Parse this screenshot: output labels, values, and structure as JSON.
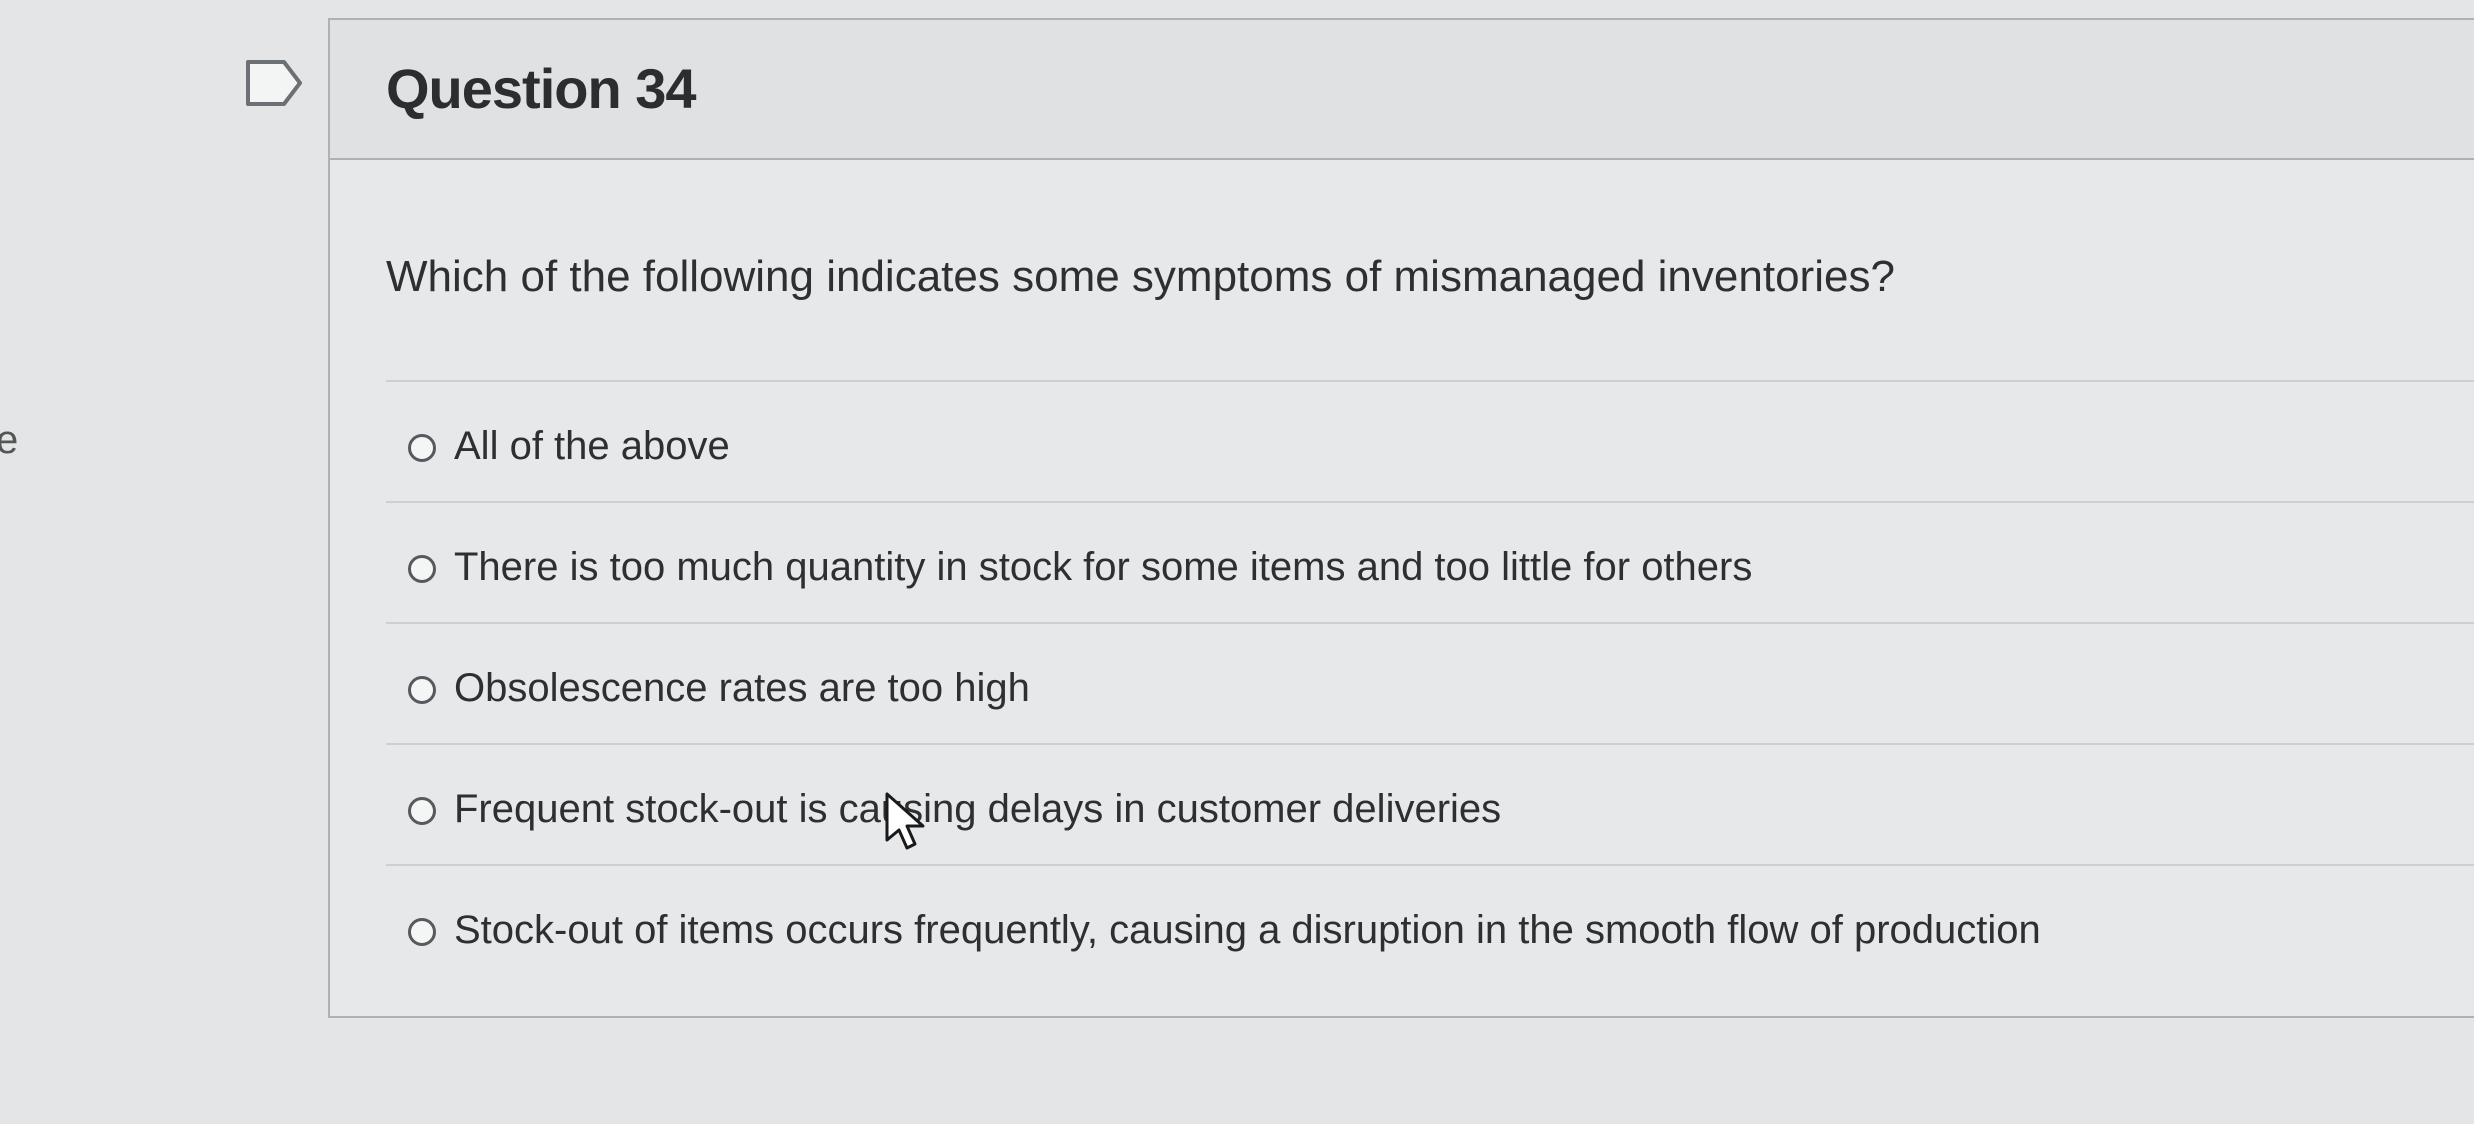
{
  "edge_text": "e",
  "question": {
    "number_label": "Question 34",
    "prompt": "Which of the following indicates some symptoms of mismanaged inventories?",
    "options": [
      {
        "label": "All of the above",
        "selected": false
      },
      {
        "label": "There is too much quantity in stock for some items and too little for others",
        "selected": false
      },
      {
        "label": "Obsolescence rates are too high",
        "selected": false
      },
      {
        "label": "Frequent stock-out is causing delays in customer deliveries",
        "selected": false
      },
      {
        "label": "Stock-out of items occurs frequently, causing a disruption in the smooth flow of production",
        "selected": false
      }
    ]
  },
  "icons": {
    "flag": "flag-icon",
    "radio": "radio-icon",
    "cursor": "mouse-pointer-icon"
  },
  "colors": {
    "background": "#e3e5e6",
    "border": "#aeb2b5",
    "text": "#2d2f31"
  }
}
